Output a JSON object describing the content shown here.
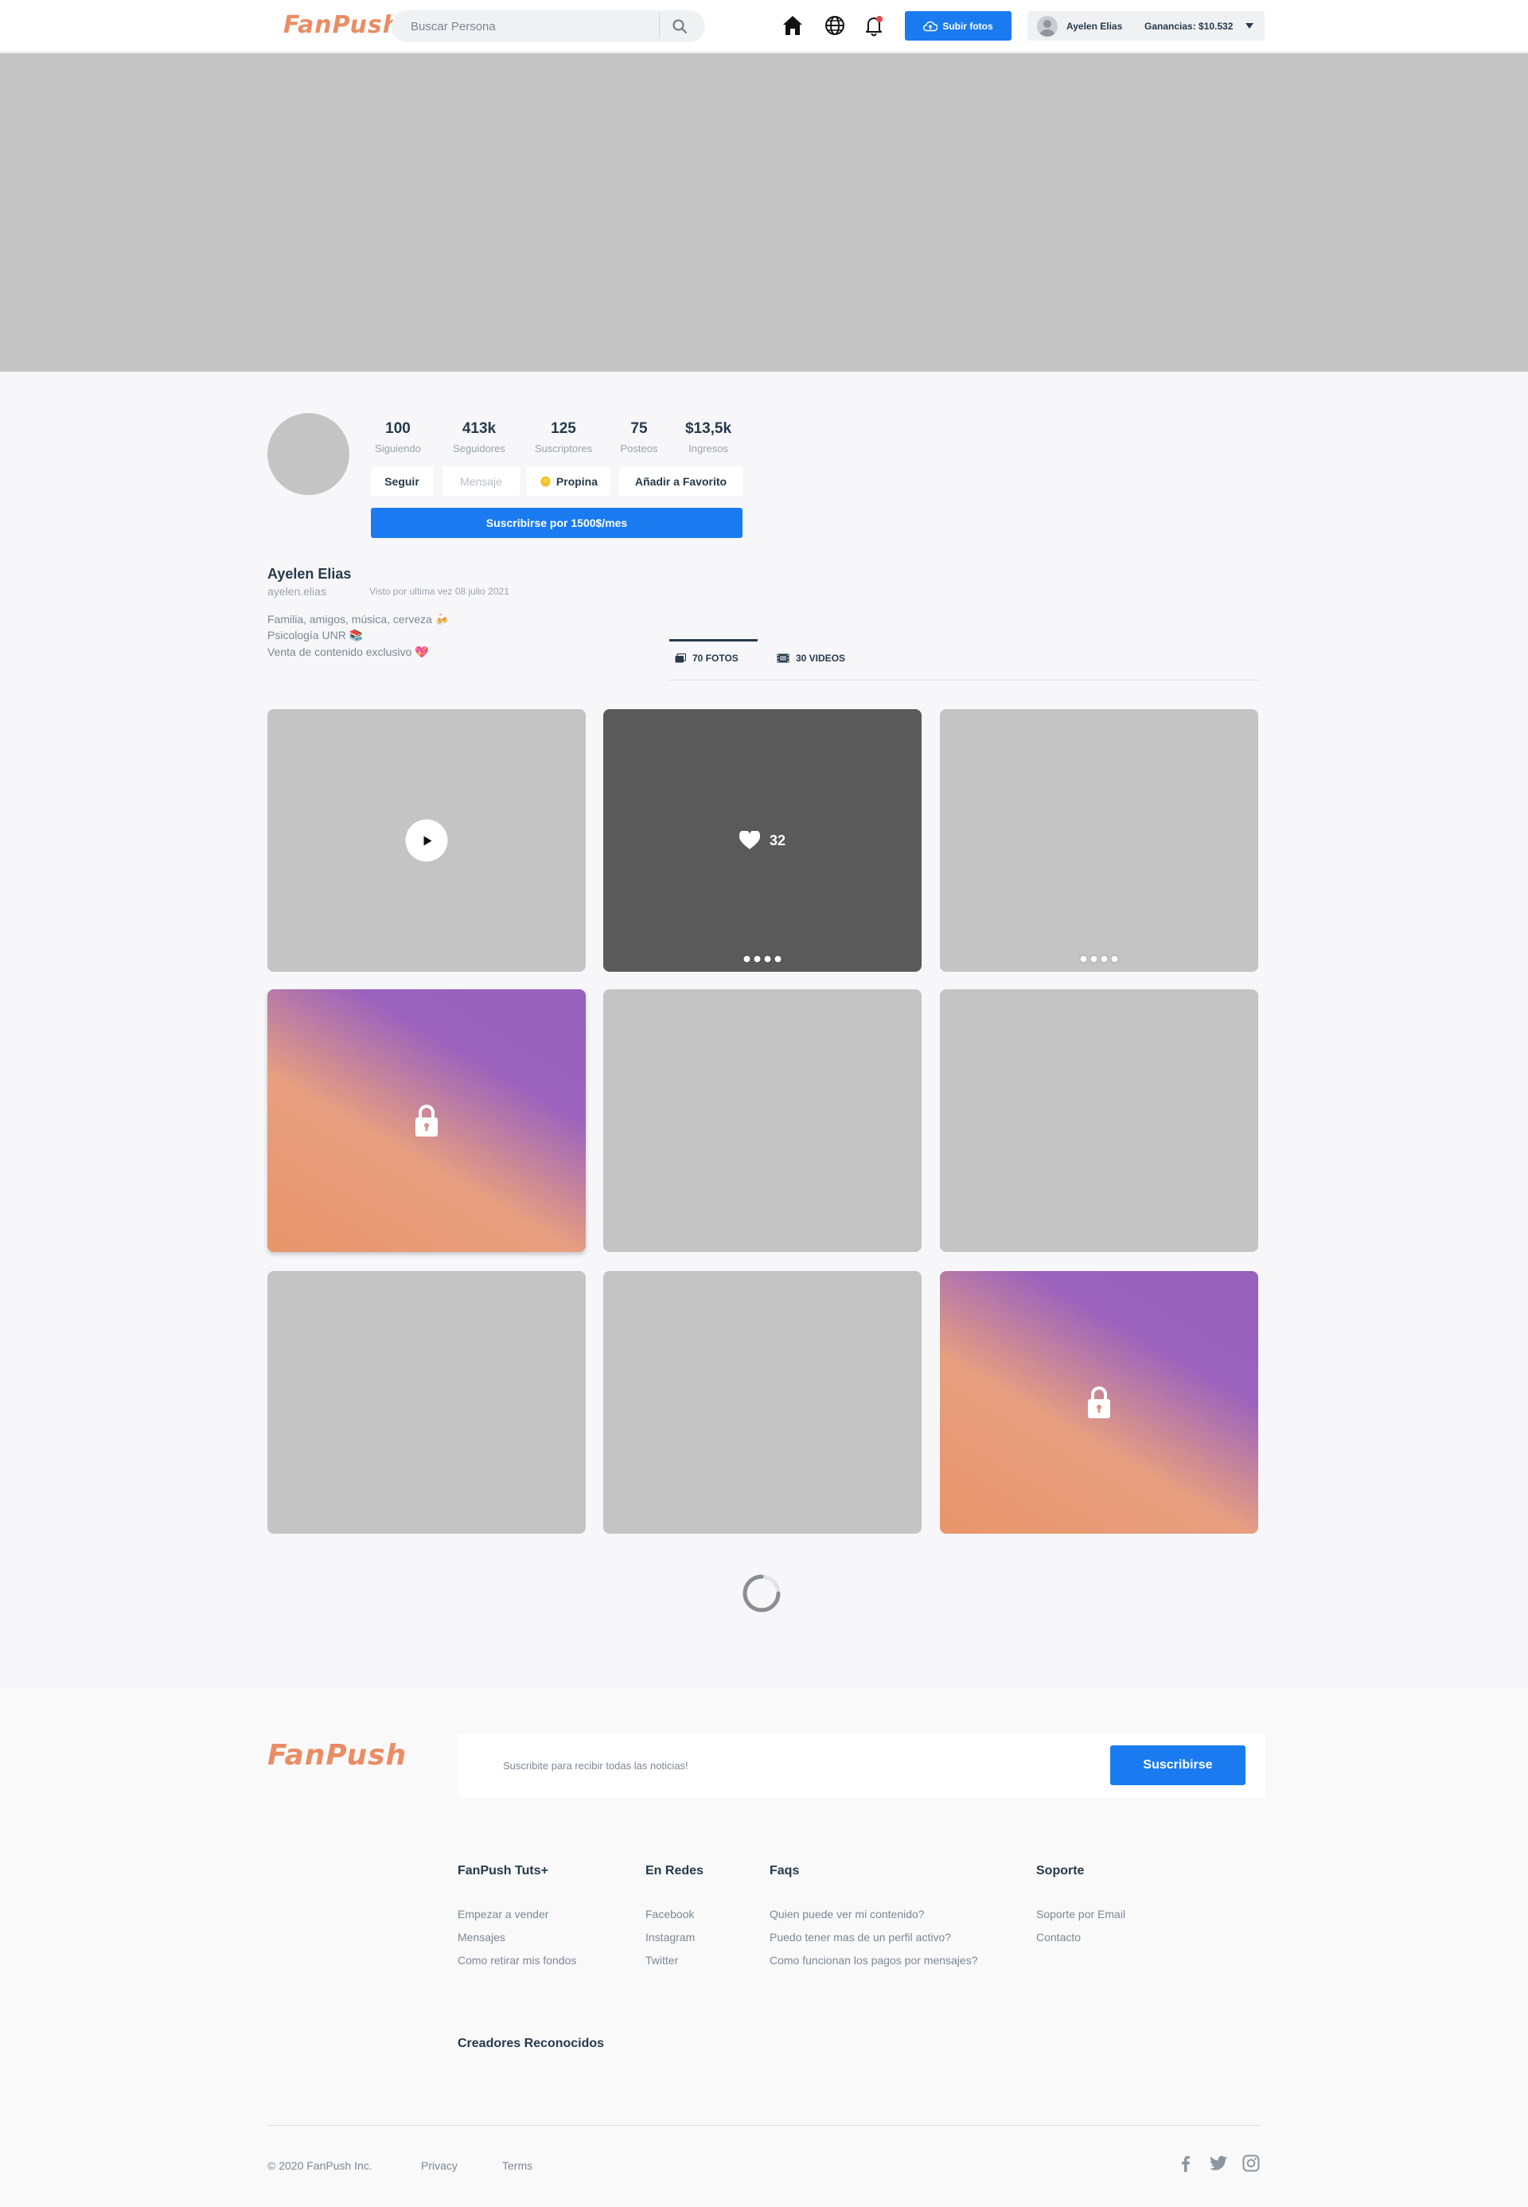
{
  "header": {
    "logo": "FanPush",
    "search_placeholder": "Buscar Persona",
    "upload_label": "Subir fotos",
    "user_name": "Ayelen Elias",
    "earnings": "Ganancias: $10.532",
    "icons": [
      "home-icon",
      "globe-icon",
      "bell-icon",
      "search-icon",
      "cloud-upload-icon",
      "chevron-down-icon"
    ]
  },
  "profile": {
    "stats": [
      {
        "value": "100",
        "label": "Siguiendo"
      },
      {
        "value": "413k",
        "label": "Seguidores"
      },
      {
        "value": "125",
        "label": "Suscriptores"
      },
      {
        "value": "75",
        "label": "Posteos"
      },
      {
        "value": "$13,5k",
        "label": "Ingresos"
      }
    ],
    "buttons": {
      "follow": "Seguir",
      "message": "Mensaje",
      "tip": "Propina",
      "favorite": "Añadir a Favorito",
      "subscribe": "Suscribirse por 1500$/mes"
    },
    "name": "Ayelen Elias",
    "handle": "ayelen.elias",
    "last_seen": "Visto por ultima vez 08 julio 2021",
    "bio": [
      "Familia, amigos, música, cerveza 🍻",
      "Psicología UNR 📚",
      "Venta de contenido exclusivo 💖"
    ]
  },
  "tabs": [
    {
      "label": "70 FOTOS",
      "icon": "photos-icon",
      "active": true
    },
    {
      "label": "30 VIDEOS",
      "icon": "film-icon",
      "active": false
    }
  ],
  "grid": {
    "likes": "32",
    "tiles": [
      "video",
      "liked-gallery",
      "gallery",
      "locked",
      "plain",
      "plain",
      "plain",
      "plain",
      "locked"
    ]
  },
  "footer": {
    "logo": "FanPush",
    "newsletter_placeholder": "Suscribite para recibir todas las noticias!",
    "newsletter_button": "Suscribirse",
    "columns": [
      {
        "title": "FanPush Tuts+",
        "links": [
          "Empezar a vender",
          "Mensajes",
          "Como retirar mis fondos"
        ]
      },
      {
        "title": "En Redes",
        "links": [
          "Facebook",
          "Instagram",
          "Twitter"
        ]
      },
      {
        "title": "Faqs",
        "links": [
          "Quien puede ver mi contenido?",
          "Puedo tener mas de un perfil activo?",
          "Como funcionan los pagos por mensajes?"
        ]
      },
      {
        "title": "Soporte",
        "links": [
          "Soporte por Email",
          "Contacto"
        ]
      }
    ],
    "recognized_title": "Creadores Reconocidos",
    "copyright": "© 2020 FanPush Inc.",
    "privacy": "Privacy",
    "terms": "Terms",
    "social_icons": [
      "facebook-icon",
      "twitter-icon",
      "instagram-icon"
    ]
  },
  "colors": {
    "accent": "#1a7bf0",
    "logo": "#ea8c64",
    "text": "#253a4b",
    "placeholder": "#c4c4c4"
  }
}
